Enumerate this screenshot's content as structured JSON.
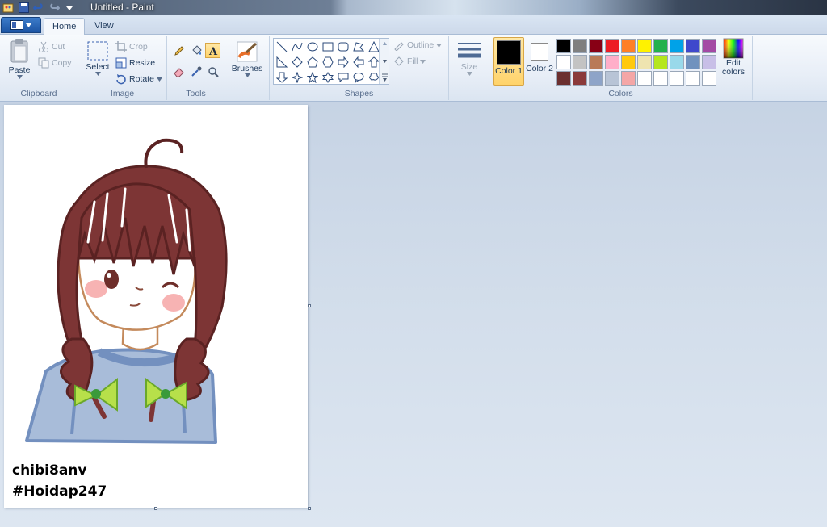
{
  "window": {
    "title": "Untitled - Paint"
  },
  "tabs": [
    {
      "label": "Home",
      "active": true
    },
    {
      "label": "View",
      "active": false
    }
  ],
  "clipboard": {
    "group_label": "Clipboard",
    "paste": "Paste",
    "cut": "Cut",
    "copy": "Copy"
  },
  "image": {
    "group_label": "Image",
    "select": "Select",
    "crop": "Crop",
    "resize": "Resize",
    "rotate": "Rotate"
  },
  "tools": {
    "group_label": "Tools",
    "items": [
      "pencil-icon",
      "fill-icon",
      "text-icon",
      "eraser-icon",
      "color-picker-icon",
      "magnifier-icon"
    ],
    "selected": "text-icon"
  },
  "brushes": {
    "label": "Brushes"
  },
  "shapes": {
    "group_label": "Shapes",
    "outline": "Outline",
    "fill": "Fill"
  },
  "size": {
    "label": "Size"
  },
  "colors": {
    "group_label": "Colors",
    "color1_label": "Color 1",
    "color2_label": "Color 2",
    "color1": "#000000",
    "color2": "#ffffff",
    "edit_label": "Edit colors",
    "palette": [
      "#000000",
      "#7f7f7f",
      "#880015",
      "#ed1c24",
      "#ff7f27",
      "#fff200",
      "#22b14c",
      "#00a2e8",
      "#3f48cc",
      "#a349a4",
      "#ffffff",
      "#c3c3c3",
      "#b97a57",
      "#ffaec9",
      "#ffc90e",
      "#efe4b0",
      "#b5e61d",
      "#99d9ea",
      "#7092be",
      "#c8bfe7",
      "#6b2f2f",
      "#8b3a3a",
      "#8ea4c8",
      "#b8c4d6",
      "#f4a6a6",
      "#ffffff",
      "#ffffff",
      "#ffffff",
      "#ffffff",
      "#ffffff"
    ]
  },
  "canvas": {
    "caption_line1": "chibi8anv",
    "caption_line2": "#Hoidap247"
  }
}
